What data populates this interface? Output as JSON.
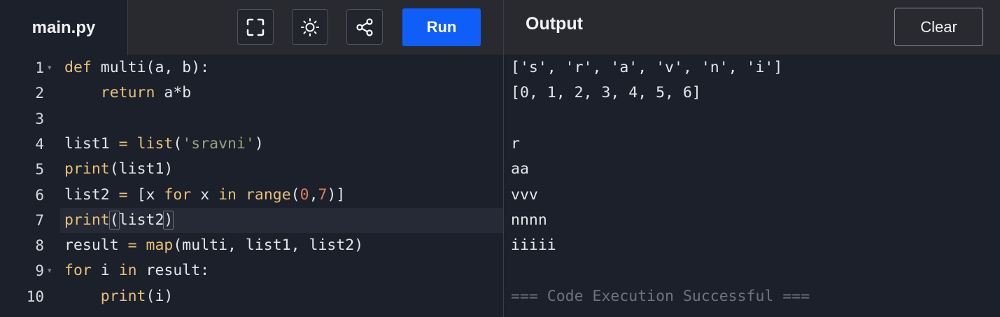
{
  "editor": {
    "tab_label": "main.py",
    "run_label": "Run",
    "toolbar_icons": [
      "fullscreen-icon",
      "theme-brightness-icon",
      "share-icon"
    ],
    "lines": [
      {
        "num": "1",
        "fold": true
      },
      {
        "num": "2",
        "fold": false
      },
      {
        "num": "3",
        "fold": false
      },
      {
        "num": "4",
        "fold": false
      },
      {
        "num": "5",
        "fold": false
      },
      {
        "num": "6",
        "fold": false
      },
      {
        "num": "7",
        "fold": false
      },
      {
        "num": "8",
        "fold": false
      },
      {
        "num": "9",
        "fold": true
      },
      {
        "num": "10",
        "fold": false
      }
    ],
    "code": {
      "l1_kw": "def",
      "l1_rest": " multi(a, b):",
      "l2_indent": "    ",
      "l2_kw": "return",
      "l2_rest": " a*b",
      "l4_a": "list1 ",
      "l4_eq": "=",
      "l4_b": " ",
      "l4_fn": "list",
      "l4_c": "(",
      "l4_str": "'sravni'",
      "l4_d": ")",
      "l5_fn": "print",
      "l5_rest": "(list1)",
      "l6_a": "list2 ",
      "l6_eq": "=",
      "l6_b": " [x ",
      "l6_for": "for",
      "l6_c": " x ",
      "l6_in": "in",
      "l6_d": " ",
      "l6_fn": "range",
      "l6_e": "(",
      "l6_n1": "0",
      "l6_f": ",",
      "l6_n2": "7",
      "l6_g": ")]",
      "l7_fn": "print",
      "l7_open": "(",
      "l7_mid": "list2",
      "l7_close": ")",
      "l8_a": "result ",
      "l8_eq": "=",
      "l8_b": " ",
      "l8_fn": "map",
      "l8_rest": "(multi, list1, list2)",
      "l9_for": "for",
      "l9_a": " i ",
      "l9_in": "in",
      "l9_b": " result:",
      "l10_indent": "    ",
      "l10_fn": "print",
      "l10_rest": "(i)"
    }
  },
  "output": {
    "title": "Output",
    "clear_label": "Clear",
    "lines": [
      "['s', 'r', 'a', 'v', 'n', 'i']",
      "[0, 1, 2, 3, 4, 5, 6]",
      "",
      "r",
      "aa",
      "vvv",
      "nnnn",
      "iiiii",
      "",
      "=== Code Execution Successful ==="
    ]
  },
  "colors": {
    "run_button": "#0f5ef7",
    "keyword": "#e5c07b",
    "string": "#98a278",
    "number": "#e07a5f"
  }
}
